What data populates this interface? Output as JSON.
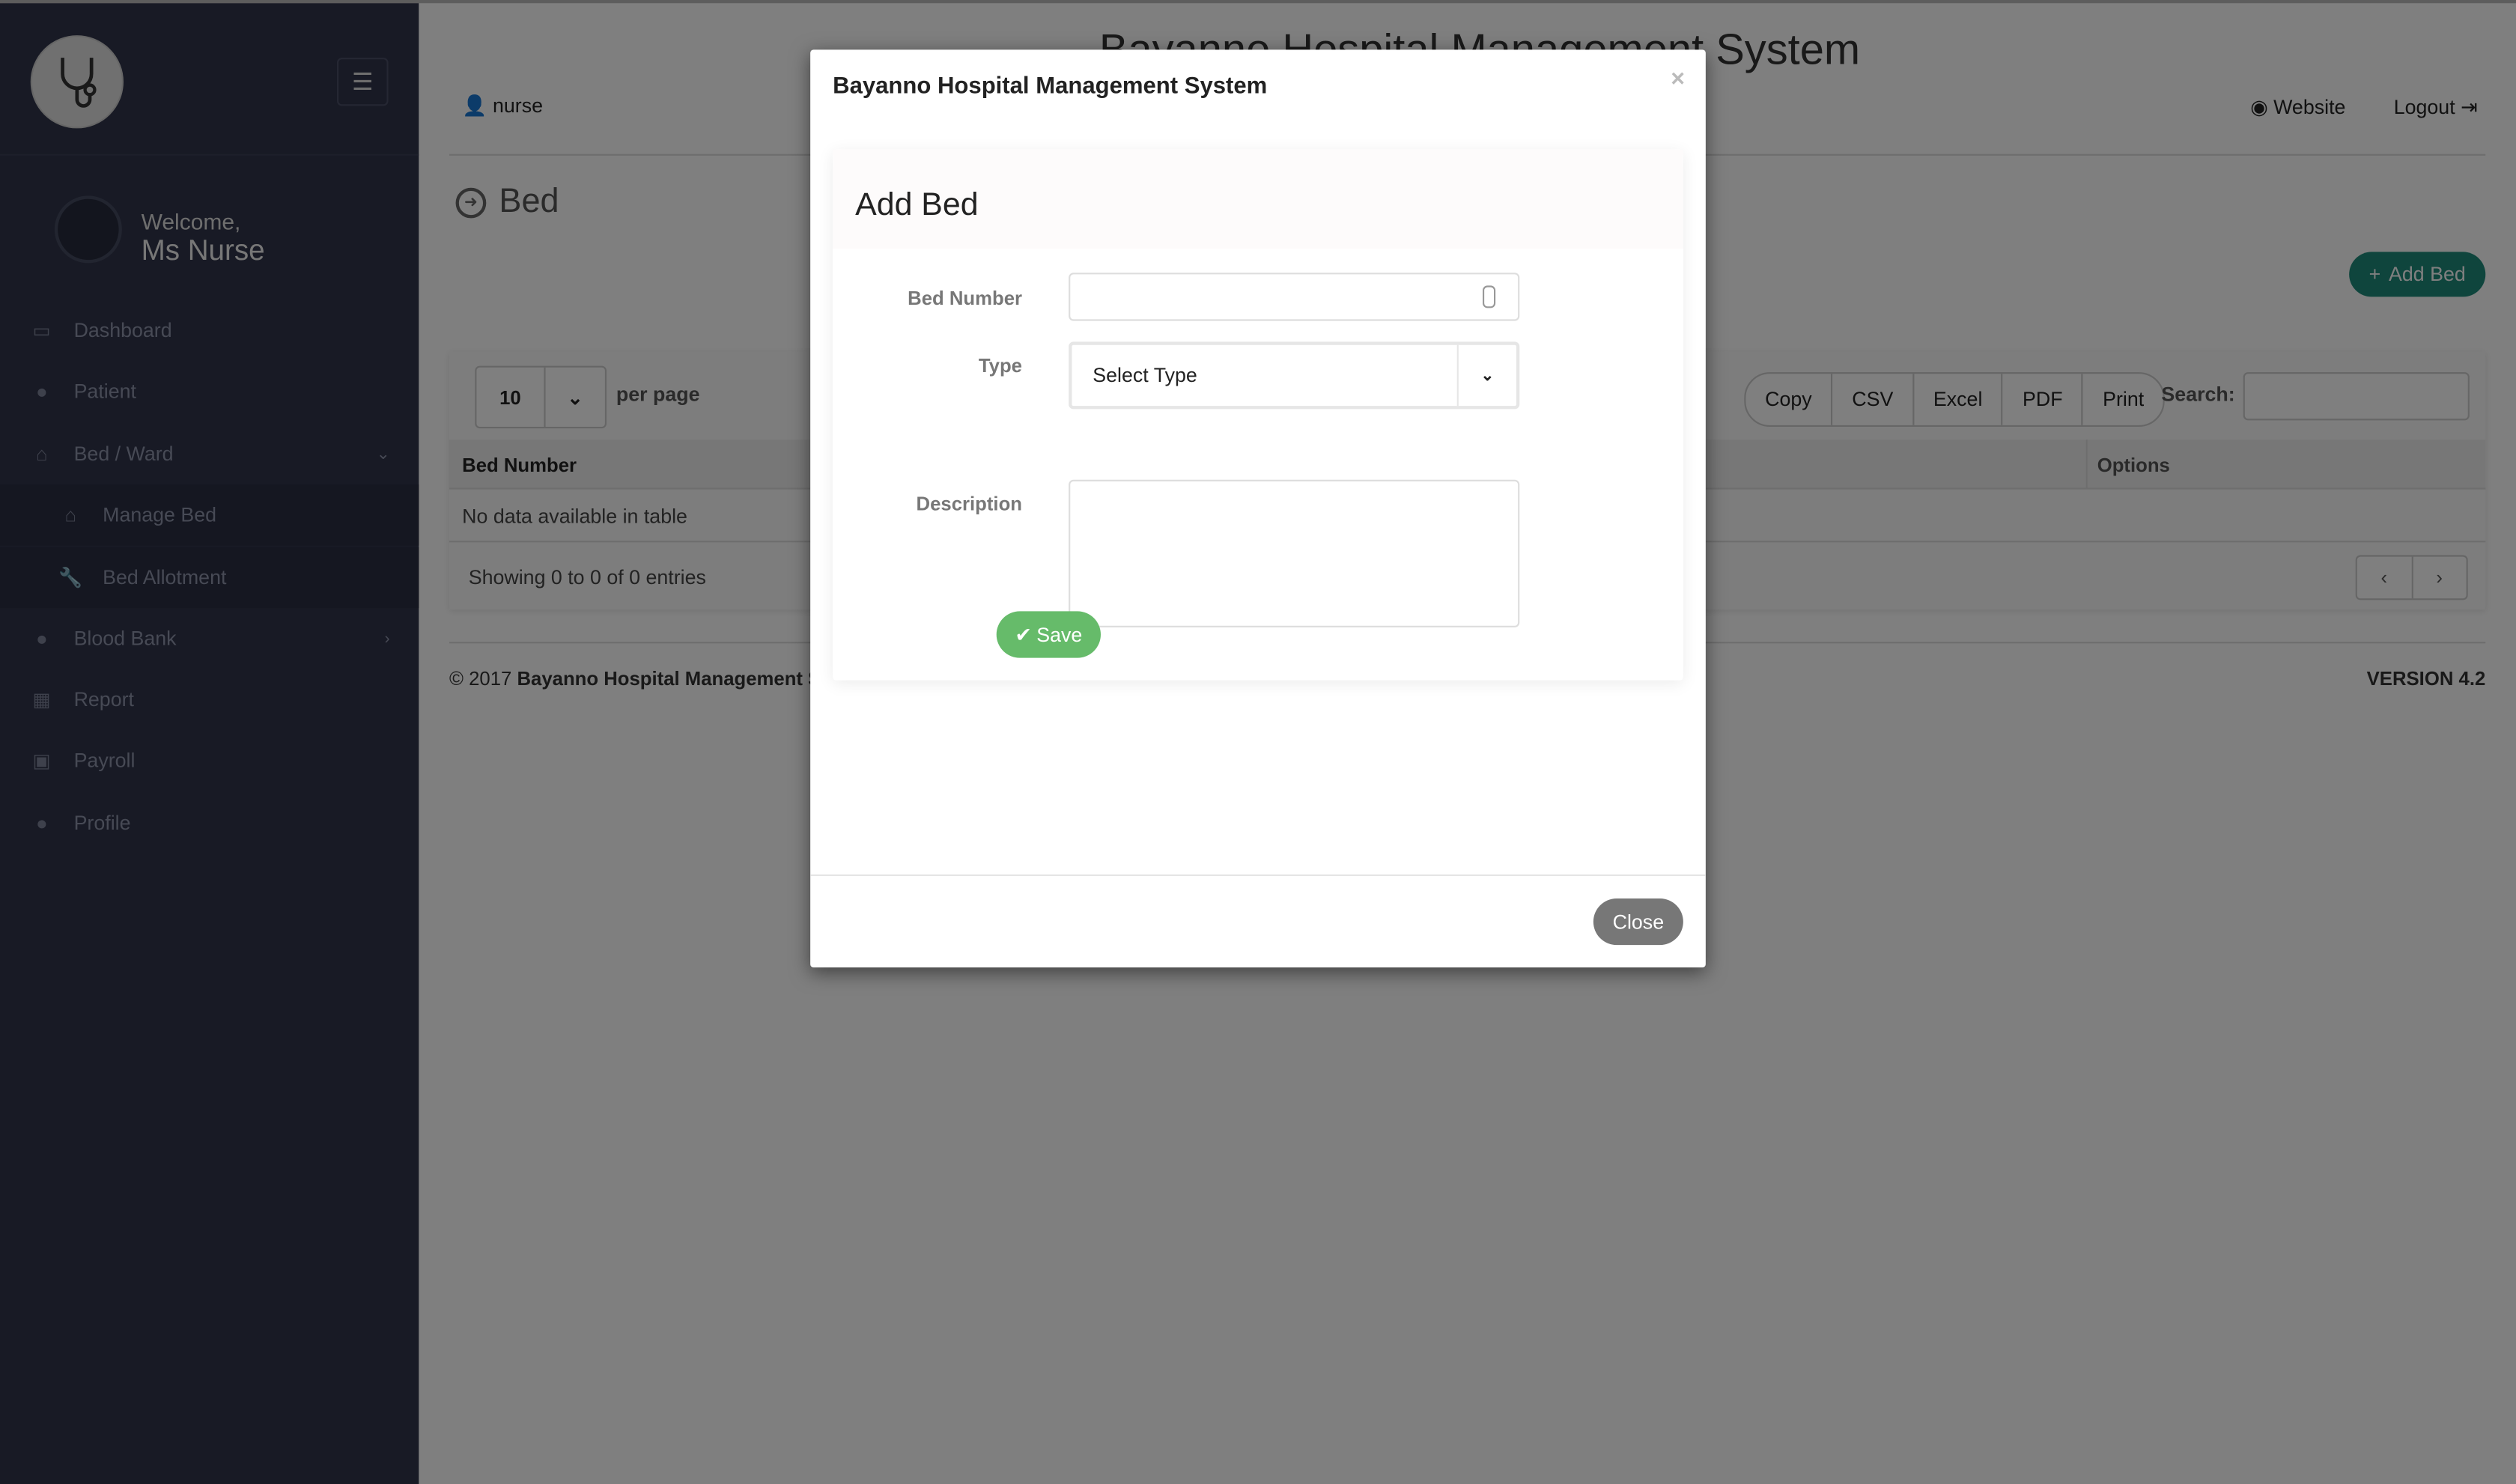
{
  "app": {
    "title": "Bayanno Hospital Management System"
  },
  "sidebar": {
    "welcome": "Welcome,",
    "user_name": "Ms Nurse",
    "items": [
      {
        "label": "Dashboard",
        "icon": "monitor-icon"
      },
      {
        "label": "Patient",
        "icon": "user-icon"
      },
      {
        "label": "Bed / Ward",
        "icon": "bed-icon",
        "expanded": true
      },
      {
        "label": "Manage Bed",
        "icon": "bed-icon"
      },
      {
        "label": "Bed Allotment",
        "icon": "wrench-icon"
      },
      {
        "label": "Blood Bank",
        "icon": "drop-icon"
      },
      {
        "label": "Report",
        "icon": "hospital-icon"
      },
      {
        "label": "Payroll",
        "icon": "money-icon"
      },
      {
        "label": "Profile",
        "icon": "user-icon"
      }
    ]
  },
  "header": {
    "user": "nurse",
    "website": "Website",
    "logout": "Logout"
  },
  "page": {
    "title": "Bed",
    "add_button": "Add Bed",
    "length_value": "10",
    "per_page": "per page",
    "export_buttons": [
      "Copy",
      "CSV",
      "Excel",
      "PDF",
      "Print"
    ],
    "search_label": "Search:",
    "search_value": "",
    "columns": [
      "Bed Number",
      "Options"
    ],
    "empty_message": "No data available in table",
    "info": "Showing 0 to 0 of 0 entries",
    "pager": [
      "‹",
      "›"
    ]
  },
  "footer": {
    "copyright_prefix": "© 2017 ",
    "copyright_name": "Bayanno Hospital Management System",
    "version": "VERSION 4.2"
  },
  "modal": {
    "title": "Bayanno Hospital Management System",
    "close_x": "×",
    "card_title": "Add Bed",
    "fields": {
      "bed_number_label": "Bed Number",
      "bed_number_value": "",
      "type_label": "Type",
      "type_value": "Select Type",
      "description_label": "Description",
      "description_value": ""
    },
    "save": "Save",
    "close": "Close"
  },
  "colors": {
    "sidebar": "#30344a",
    "accent": "#1f8a7a",
    "save": "#66bb6a",
    "close": "#777777"
  }
}
